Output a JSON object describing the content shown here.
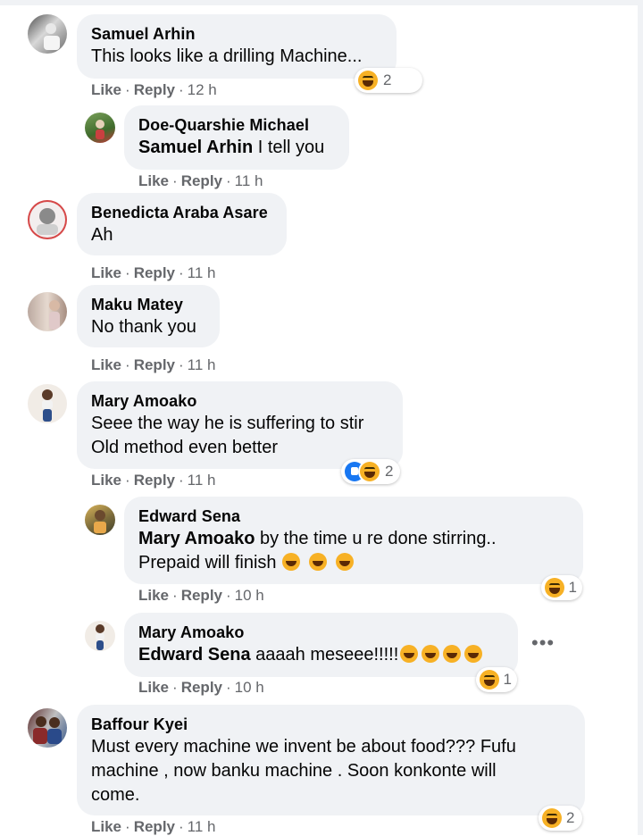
{
  "actions": {
    "like": "Like",
    "reply": "Reply",
    "dot": "·"
  },
  "more_icon": "more-horizontal-icon",
  "comments": [
    {
      "name": "Samuel Arhin",
      "text": "This looks like a drilling Machine...",
      "time": "12 h",
      "reaction_count": "2",
      "reactions": [
        "haha"
      ]
    },
    {
      "name": "Doe-Quarshie Michael",
      "mention": "Samuel Arhin",
      "text": " I tell you",
      "time": "11 h"
    },
    {
      "name": "Benedicta Araba Asare",
      "text": "Ah",
      "time": "11 h"
    },
    {
      "name": "Maku Matey",
      "text": "No thank you",
      "time": "11 h"
    },
    {
      "name": "Mary Amoako",
      "text_line1": "Seee the way he is suffering to stir",
      "text_line2": "Old method even better",
      "time": "11 h",
      "reaction_count": "2",
      "reactions": [
        "like",
        "haha"
      ]
    },
    {
      "name": "Edward Sena",
      "mention": "Mary Amoako",
      "text_line1": " by the time u re done stirring..",
      "text_line2": "Prepaid will finish",
      "time": "10 h",
      "reaction_count": "1",
      "reactions": [
        "haha"
      ]
    },
    {
      "name": "Mary Amoako",
      "mention": "Edward Sena",
      "text": " aaaah meseee!!!!!",
      "time": "10 h",
      "reaction_count": "1",
      "reactions": [
        "haha"
      ]
    },
    {
      "name": "Baffour Kyei",
      "text_line1": "Must every machine we invent be about food??? Fufu",
      "text_line2": "machine , now banku machine . Soon konkonte will",
      "text_line3": "come.",
      "time": "11 h",
      "reaction_count": "2",
      "reactions": [
        "haha"
      ]
    }
  ]
}
